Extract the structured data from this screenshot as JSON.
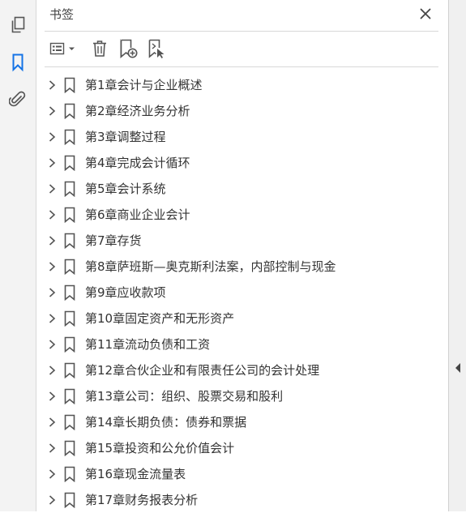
{
  "rail": {
    "items": [
      {
        "name": "pages-icon",
        "active": false
      },
      {
        "name": "bookmark-icon",
        "active": true
      },
      {
        "name": "attachment-icon",
        "active": false
      }
    ]
  },
  "panel": {
    "title": "书签",
    "close_icon": "close-icon",
    "toolbar": [
      {
        "name": "options-menu-icon"
      },
      {
        "name": "delete-bookmark-icon"
      },
      {
        "name": "new-bookmark-icon"
      },
      {
        "name": "bookmark-from-selection-icon"
      }
    ]
  },
  "bookmarks": [
    {
      "label": "第1章会计与企业概述"
    },
    {
      "label": "第2章经济业务分析"
    },
    {
      "label": "第3章调整过程"
    },
    {
      "label": "第4章完成会计循环"
    },
    {
      "label": "第5章会计系统"
    },
    {
      "label": "第6章商业企业会计"
    },
    {
      "label": "第7章存货"
    },
    {
      "label": "第8章萨班斯—奥克斯利法案，内部控制与现金"
    },
    {
      "label": "第9章应收款项"
    },
    {
      "label": "第10章固定资产和无形资产"
    },
    {
      "label": "第11章流动负债和工资"
    },
    {
      "label": "第12章合伙企业和有限责任公司的会计处理"
    },
    {
      "label": "第13章公司：组织、股票交易和股利"
    },
    {
      "label": "第14章长期负债：债券和票据"
    },
    {
      "label": "第15章投资和公允价值会计"
    },
    {
      "label": "第16章现金流量表"
    },
    {
      "label": "第17章财务报表分析"
    }
  ],
  "colors": {
    "accent": "#1473e6",
    "icon": "#555555",
    "text": "#333333"
  }
}
